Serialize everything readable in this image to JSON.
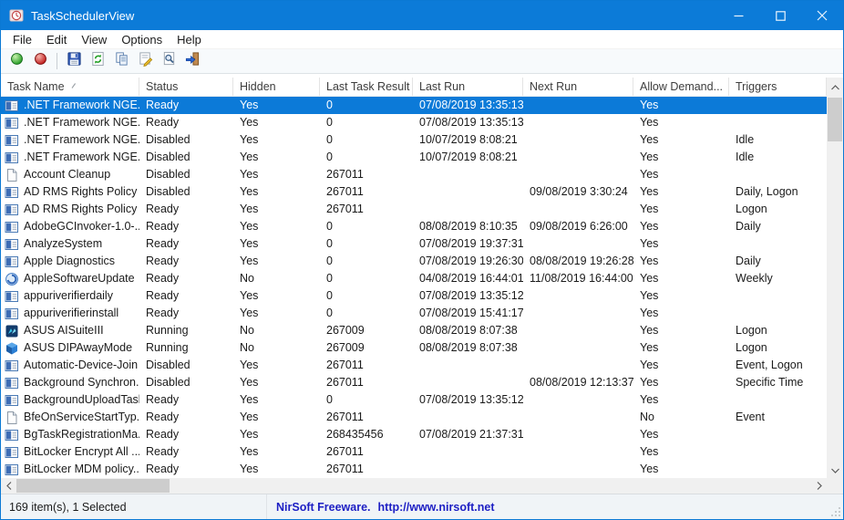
{
  "window": {
    "title": "TaskSchedulerView",
    "controls": {
      "minimize": "minimize",
      "maximize": "maximize",
      "close": "close"
    }
  },
  "menu": {
    "items": [
      "File",
      "Edit",
      "View",
      "Options",
      "Help"
    ]
  },
  "toolbar": {
    "buttons": [
      {
        "name": "run-task-button",
        "icon": "green-ball-icon"
      },
      {
        "name": "stop-task-button",
        "icon": "red-ball-icon"
      },
      {
        "name": "separator",
        "icon": "separator"
      },
      {
        "name": "save-button",
        "icon": "save-icon"
      },
      {
        "name": "refresh-button",
        "icon": "refresh-icon"
      },
      {
        "name": "copy-button",
        "icon": "copy-icon"
      },
      {
        "name": "properties-button",
        "icon": "properties-icon"
      },
      {
        "name": "find-button",
        "icon": "find-icon"
      },
      {
        "name": "advanced-options-button",
        "icon": "exit-door-icon"
      }
    ]
  },
  "table": {
    "columns": [
      {
        "key": "name",
        "label": "Task Name",
        "width": 152,
        "sorted": true
      },
      {
        "key": "status",
        "label": "Status",
        "width": 103
      },
      {
        "key": "hidden",
        "label": "Hidden",
        "width": 95
      },
      {
        "key": "last_result",
        "label": "Last Task Result",
        "width": 102
      },
      {
        "key": "last_run",
        "label": "Last Run",
        "width": 121
      },
      {
        "key": "next_run",
        "label": "Next Run",
        "width": 121
      },
      {
        "key": "allow_demand",
        "label": "Allow Demand...",
        "width": 105
      },
      {
        "key": "triggers",
        "label": "Triggers",
        "width": 107
      }
    ]
  },
  "rows": [
    {
      "name": ".NET Framework NGE...",
      "icon": "task",
      "status": "Ready",
      "hidden": "Yes",
      "last_result": "0",
      "last_run": "07/08/2019 13:35:13",
      "next_run": "",
      "allow_demand": "Yes",
      "triggers": "",
      "selected": true
    },
    {
      "name": ".NET Framework NGE...",
      "icon": "task",
      "status": "Ready",
      "hidden": "Yes",
      "last_result": "0",
      "last_run": "07/08/2019 13:35:13",
      "next_run": "",
      "allow_demand": "Yes",
      "triggers": ""
    },
    {
      "name": ".NET Framework NGE...",
      "icon": "task",
      "status": "Disabled",
      "hidden": "Yes",
      "last_result": "0",
      "last_run": "10/07/2019 8:08:21",
      "next_run": "",
      "allow_demand": "Yes",
      "triggers": "Idle"
    },
    {
      "name": ".NET Framework NGE...",
      "icon": "task",
      "status": "Disabled",
      "hidden": "Yes",
      "last_result": "0",
      "last_run": "10/07/2019 8:08:21",
      "next_run": "",
      "allow_demand": "Yes",
      "triggers": "Idle"
    },
    {
      "name": "Account Cleanup",
      "icon": "doc",
      "status": "Disabled",
      "hidden": "Yes",
      "last_result": "267011",
      "last_run": "",
      "next_run": "",
      "allow_demand": "Yes",
      "triggers": ""
    },
    {
      "name": "AD RMS Rights Policy ...",
      "icon": "task",
      "status": "Disabled",
      "hidden": "Yes",
      "last_result": "267011",
      "last_run": "",
      "next_run": "09/08/2019 3:30:24",
      "allow_demand": "Yes",
      "triggers": "Daily, Logon"
    },
    {
      "name": "AD RMS Rights Policy ...",
      "icon": "task",
      "status": "Ready",
      "hidden": "Yes",
      "last_result": "267011",
      "last_run": "",
      "next_run": "",
      "allow_demand": "Yes",
      "triggers": "Logon"
    },
    {
      "name": "AdobeGCInvoker-1.0-...",
      "icon": "task",
      "status": "Ready",
      "hidden": "Yes",
      "last_result": "0",
      "last_run": "08/08/2019 8:10:35",
      "next_run": "09/08/2019 6:26:00",
      "allow_demand": "Yes",
      "triggers": "Daily"
    },
    {
      "name": "AnalyzeSystem",
      "icon": "task",
      "status": "Ready",
      "hidden": "Yes",
      "last_result": "0",
      "last_run": "07/08/2019 19:37:31",
      "next_run": "",
      "allow_demand": "Yes",
      "triggers": ""
    },
    {
      "name": "Apple Diagnostics",
      "icon": "task",
      "status": "Ready",
      "hidden": "Yes",
      "last_result": "0",
      "last_run": "07/08/2019 19:26:30",
      "next_run": "08/08/2019 19:26:28",
      "allow_demand": "Yes",
      "triggers": "Daily"
    },
    {
      "name": "AppleSoftwareUpdate",
      "icon": "swirl",
      "status": "Ready",
      "hidden": "No",
      "last_result": "0",
      "last_run": "04/08/2019 16:44:01",
      "next_run": "11/08/2019 16:44:00",
      "allow_demand": "Yes",
      "triggers": "Weekly"
    },
    {
      "name": "appuriverifierdaily",
      "icon": "task",
      "status": "Ready",
      "hidden": "Yes",
      "last_result": "0",
      "last_run": "07/08/2019 13:35:12",
      "next_run": "",
      "allow_demand": "Yes",
      "triggers": ""
    },
    {
      "name": "appuriverifierinstall",
      "icon": "task",
      "status": "Ready",
      "hidden": "Yes",
      "last_result": "0",
      "last_run": "07/08/2019 15:41:17",
      "next_run": "",
      "allow_demand": "Yes",
      "triggers": ""
    },
    {
      "name": "ASUS AISuiteIII",
      "icon": "asus-ai",
      "status": "Running",
      "hidden": "No",
      "last_result": "267009",
      "last_run": "08/08/2019 8:07:38",
      "next_run": "",
      "allow_demand": "Yes",
      "triggers": "Logon"
    },
    {
      "name": "ASUS DIPAwayMode",
      "icon": "asus-dip",
      "status": "Running",
      "hidden": "No",
      "last_result": "267009",
      "last_run": "08/08/2019 8:07:38",
      "next_run": "",
      "allow_demand": "Yes",
      "triggers": "Logon"
    },
    {
      "name": "Automatic-Device-Join",
      "icon": "task",
      "status": "Disabled",
      "hidden": "Yes",
      "last_result": "267011",
      "last_run": "",
      "next_run": "",
      "allow_demand": "Yes",
      "triggers": "Event, Logon"
    },
    {
      "name": "Background Synchron...",
      "icon": "task",
      "status": "Disabled",
      "hidden": "Yes",
      "last_result": "267011",
      "last_run": "",
      "next_run": "08/08/2019 12:13:37",
      "allow_demand": "Yes",
      "triggers": "Specific Time"
    },
    {
      "name": "BackgroundUploadTask",
      "icon": "task",
      "status": "Ready",
      "hidden": "Yes",
      "last_result": "0",
      "last_run": "07/08/2019 13:35:12",
      "next_run": "",
      "allow_demand": "Yes",
      "triggers": ""
    },
    {
      "name": "BfeOnServiceStartTyp...",
      "icon": "doc",
      "status": "Ready",
      "hidden": "Yes",
      "last_result": "267011",
      "last_run": "",
      "next_run": "",
      "allow_demand": "No",
      "triggers": "Event"
    },
    {
      "name": "BgTaskRegistrationMa...",
      "icon": "task",
      "status": "Ready",
      "hidden": "Yes",
      "last_result": "268435456",
      "last_run": "07/08/2019 21:37:31",
      "next_run": "",
      "allow_demand": "Yes",
      "triggers": ""
    },
    {
      "name": "BitLocker Encrypt All ...",
      "icon": "task",
      "status": "Ready",
      "hidden": "Yes",
      "last_result": "267011",
      "last_run": "",
      "next_run": "",
      "allow_demand": "Yes",
      "triggers": ""
    },
    {
      "name": "BitLocker MDM policy...",
      "icon": "task",
      "status": "Ready",
      "hidden": "Yes",
      "last_result": "267011",
      "last_run": "",
      "next_run": "",
      "allow_demand": "Yes",
      "triggers": ""
    }
  ],
  "statusbar": {
    "count_text": "169 item(s), 1 Selected",
    "brand": "NirSoft Freeware.",
    "url": "http://www.nirsoft.net"
  },
  "colors": {
    "titlebar": "#0c7bd8",
    "selection": "#0c7ad8",
    "link": "#1d1fc4"
  }
}
